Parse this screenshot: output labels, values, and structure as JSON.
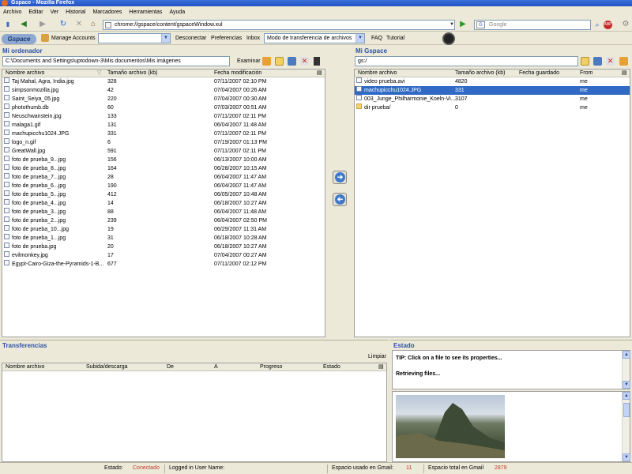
{
  "window": {
    "title": "Gspace - Mozilla Firefox"
  },
  "menu": [
    "Archivo",
    "Editar",
    "Ver",
    "Historial",
    "Marcadores",
    "Herramientas",
    "Ayuda"
  ],
  "nav": {
    "url": "chrome://gspace/content/gspaceWindow.xul",
    "search_placeholder": "Google"
  },
  "gtoolbar": {
    "logo": "Gspace",
    "manage_accounts": "Manage Accounts",
    "account_value": "",
    "disconnect": "Desconectar",
    "preferences": "Preferencias",
    "inbox": "Inbox",
    "mode_value": "Modo de transferencia de archivos",
    "faq": "FAQ",
    "tutorial": "Tutorial"
  },
  "local": {
    "title": "Mi ordenador",
    "path": "C:\\Documents and Settings\\uptodown-3\\Mis documentos\\Mis imágenes",
    "browse": "Examinar",
    "headers": [
      "Nombre archivo",
      "Tamaño archivo (kb)",
      "Fecha modificación"
    ],
    "files": [
      [
        "Taj Mahal, Agra, India.jpg",
        "328",
        "07/11/2007 02:10 PM"
      ],
      [
        "simpsonmozilla.jpg",
        "42",
        "07/04/2007 00:26 AM"
      ],
      [
        "Saint_Seiya_05.jpg",
        "220",
        "07/04/2007 00:30 AM"
      ],
      [
        "photothumb.db",
        "60",
        "07/03/2007 00:51 AM"
      ],
      [
        "Neuschwanstein.jpg",
        "133",
        "07/11/2007 02:11 PM"
      ],
      [
        "malaga1.gif",
        "131",
        "06/04/2007 11:48 AM"
      ],
      [
        "machupicchu1024.JPG",
        "331",
        "07/11/2007 02:11 PM"
      ],
      [
        "logo_n.gif",
        "6",
        "07/19/2007 01:13 PM"
      ],
      [
        "GreatWall.jpg",
        "591",
        "07/11/2007 02:11 PM"
      ],
      [
        "foto de prueba_9...jpg",
        "156",
        "06/13/2007 10:00 AM"
      ],
      [
        "foto de prueba_8...jpg",
        "164",
        "06/28/2007 10:15 AM"
      ],
      [
        "foto de prueba_7...jpg",
        "28",
        "06/04/2007 11:47 AM"
      ],
      [
        "foto de prueba_6...jpg",
        "190",
        "06/04/2007 11:47 AM"
      ],
      [
        "foto de prueba_5...jpg",
        "412",
        "06/05/2007 10:48 AM"
      ],
      [
        "foto de prueba_4...jpg",
        "14",
        "06/18/2007 10:27 AM"
      ],
      [
        "foto de prueba_3...jpg",
        "88",
        "06/04/2007 11:48 AM"
      ],
      [
        "foto de prueba_2...jpg",
        "239",
        "06/04/2007 02:50 PM"
      ],
      [
        "foto de prueba_10...jpg",
        "19",
        "06/29/2007 11:31 AM"
      ],
      [
        "foto de prueba_1...jpg",
        "31",
        "06/18/2007 10:28 AM"
      ],
      [
        "foto de prueba.jpg",
        "20",
        "06/18/2007 10:27 AM"
      ],
      [
        "evilmonkey.jpg",
        "17",
        "07/04/2007 00:27 AM"
      ],
      [
        "Egypt-Cairo-Giza-the-Pyramids-1-B...",
        "677",
        "07/11/2007 02:12 PM"
      ]
    ]
  },
  "remote": {
    "title": "Mi Gspace",
    "path": "gs:/",
    "headers": [
      "Nombre archivo",
      "Tamaño archivo (kb)",
      "Fecha guardado",
      "From"
    ],
    "files": [
      [
        "video prueba.avi",
        "4820",
        "",
        "me"
      ],
      [
        "machupicchu1024.JPG",
        "331",
        "",
        "me"
      ],
      [
        "003_Junge_Philharmonie_Koeln-Vi...",
        "3107",
        "",
        "me"
      ],
      [
        "dir prueba/",
        "0",
        "",
        "me"
      ]
    ],
    "selected_index": 1
  },
  "transfers": {
    "title": "Transferencias",
    "clear": "Limpiar",
    "headers": [
      "Nombre archivo",
      "Subida/descarga",
      "De",
      "A",
      "Progreso",
      "Estado"
    ]
  },
  "estado": {
    "title": "Estado",
    "tip": "TIP: Click on a file to see its properties...",
    "retrieving": "Retrieving files..."
  },
  "status": {
    "estado_label": "Estado:",
    "estado_value": "Conectado",
    "logged_label": "Logged in User Name:",
    "logged_value": "",
    "used_label": "Espacio usado en Gmail:",
    "used_value": "11",
    "total_label": "Espacio total en Gmail",
    "total_value": "2879"
  },
  "colors": {
    "accent": "#2a52a6",
    "selection": "#316ac5",
    "status_red": "#c0392b"
  }
}
